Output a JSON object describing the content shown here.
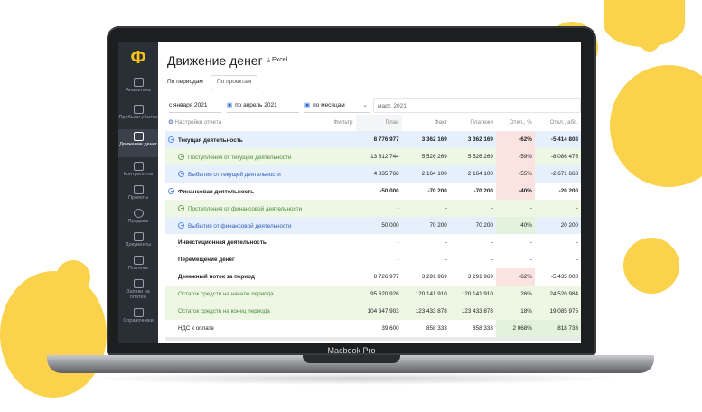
{
  "device_label": "Macbook Pro",
  "app": {
    "logo": "Ф",
    "title": "Движение денег",
    "export_label": "Excel",
    "tabs": [
      "По периодам",
      "По проектам"
    ],
    "filters": {
      "from": "с января 2021",
      "to": "по апрель 2021",
      "step": "по месяцам",
      "period_preview": "март, 2021"
    }
  },
  "sidebar": {
    "items": [
      {
        "label": "Аналитика",
        "icon": "chart-icon"
      },
      {
        "label": "Прибыли убытки",
        "icon": "profit-icon"
      },
      {
        "label": "Движение денег",
        "icon": "money-flow-icon",
        "active": true
      },
      {
        "label": "Контрагенты",
        "icon": "contractors-icon"
      },
      {
        "label": "Проекты",
        "icon": "projects-icon"
      },
      {
        "label": "Продажи",
        "icon": "sales-icon"
      },
      {
        "label": "Документы",
        "icon": "documents-icon"
      },
      {
        "label": "Платежи",
        "icon": "payments-icon"
      },
      {
        "label": "Заявки на платеж",
        "icon": "requests-icon"
      },
      {
        "label": "Справочники",
        "icon": "catalogs-icon"
      }
    ]
  },
  "table": {
    "settings_label": "Настройки отчета",
    "filter_label": "Фильтр",
    "columns": [
      "План",
      "Факт",
      "Платежи",
      "Откл., %",
      "Откл., абс."
    ],
    "rows": [
      {
        "name": "Текущая деятельность",
        "plan": "8 776 977",
        "fact": "3 362 169",
        "pay": "3 362 169",
        "pct": "-62%",
        "abs": "-5 414 808"
      },
      {
        "name": "Поступления от текущей деятельности",
        "plan": "13 612 744",
        "fact": "5 526 269",
        "pay": "5 526 269",
        "pct": "-59%",
        "abs": "-8 086 475"
      },
      {
        "name": "Выбытия от текущей деятельности",
        "plan": "4 835 768",
        "fact": "2 164 100",
        "pay": "2 164 100",
        "pct": "-55%",
        "abs": "-2 671 668"
      },
      {
        "name": "Финансовая деятельность",
        "plan": "-50 000",
        "fact": "-70 200",
        "pay": "-70 200",
        "pct": "-40%",
        "abs": "-20 200"
      },
      {
        "name": "Поступления от финансовой деятельности",
        "plan": "-",
        "fact": "-",
        "pay": "-",
        "pct": "-",
        "abs": "-"
      },
      {
        "name": "Выбытия от финансовой деятельности",
        "plan": "50 000",
        "fact": "70 200",
        "pay": "70 200",
        "pct": "40%",
        "abs": "20 200"
      },
      {
        "name": "Инвестиционная деятельность",
        "plan": "-",
        "fact": "-",
        "pay": "-",
        "pct": "-",
        "abs": "-"
      },
      {
        "name": "Перемещение денег",
        "plan": "-",
        "fact": "-",
        "pay": "-",
        "pct": "-",
        "abs": "-"
      },
      {
        "name": "Денежный поток за период",
        "plan": "8 726 977",
        "fact": "3 291 969",
        "pay": "3 291 969",
        "pct": "-62%",
        "abs": "-5 435 008"
      },
      {
        "name": "Остаток средств на начало периода",
        "plan": "95 620 926",
        "fact": "120 141 910",
        "pay": "120 141 910",
        "pct": "26%",
        "abs": "24 520 984"
      },
      {
        "name": "Остаток средств на конец периода",
        "plan": "104 347 903",
        "fact": "123 433 878",
        "pay": "123 433 878",
        "pct": "18%",
        "abs": "19 085 975"
      },
      {
        "name": "НДС к оплате",
        "plan": "39 600",
        "fact": "858 333",
        "pay": "858 333",
        "pct": "2 068%",
        "abs": "818 733"
      }
    ]
  },
  "colors": {
    "accent": "#f5c21b",
    "sidebar": "#2a2f36",
    "blue_row": "#e6effc",
    "green_row": "#eef6e4",
    "negative": "#fbe3e2",
    "positive": "#e2f2dc"
  }
}
